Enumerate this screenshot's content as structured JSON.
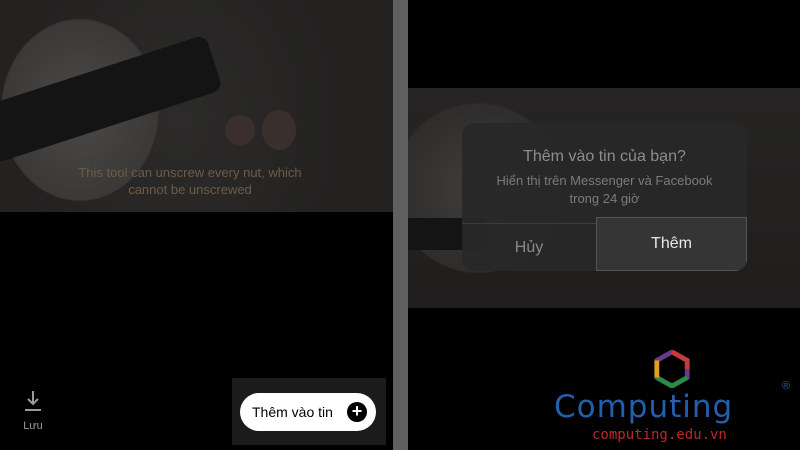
{
  "left": {
    "subtitle_line1": "This tool can unscrew every nut, which",
    "subtitle_line2": "cannot be unscrewed",
    "save_label": "Lưu",
    "add_story_label": "Thêm vào tin",
    "add_icon": "plus-circle-icon"
  },
  "dialog": {
    "title": "Thêm vào tin của bạn?",
    "message_line1": "Hiển thị trên Messenger và Facebook",
    "message_line2": "trong 24 giờ",
    "cancel_label": "Hủy",
    "confirm_label": "Thêm"
  },
  "watermark": {
    "name": "Computing",
    "registered": "®",
    "url": "computing.edu.vn"
  }
}
